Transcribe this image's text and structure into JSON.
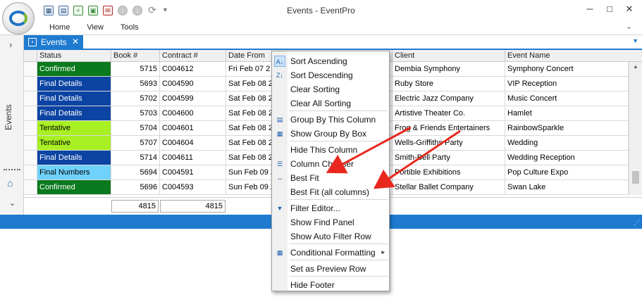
{
  "window": {
    "title": "Events - EventPro",
    "menu": [
      "Home",
      "View",
      "Tools"
    ]
  },
  "quick_access_icons": [
    "calendar-icon",
    "grid-icon",
    "add-event-icon",
    "map-icon",
    "mail-icon",
    "up-icon",
    "down-icon",
    "refresh-icon",
    "customize-icon"
  ],
  "left_nav": {
    "label": "Events"
  },
  "doc_tab": {
    "label": "Events",
    "close": "✕"
  },
  "grid": {
    "columns": [
      "Status",
      "Book #",
      "Contract #",
      "Date From",
      "",
      "Client",
      "Event Name"
    ],
    "rows": [
      {
        "status": "Confirmed",
        "status_color": "#0b7a1e",
        "book": "5715",
        "contract": "C004612",
        "date": "Fri Feb 07 2",
        "client": "Dembia Symphony",
        "event": "Symphony Concert"
      },
      {
        "status": "Final Details",
        "status_color": "#0c44a3",
        "book": "5693",
        "contract": "C004590",
        "date": "Sat Feb 08 2",
        "client": "Ruby Store",
        "event": "VIP Reception"
      },
      {
        "status": "Final Details",
        "status_color": "#0c44a3",
        "book": "5702",
        "contract": "C004599",
        "date": "Sat Feb 08 2",
        "client": "Electric Jazz Company",
        "event": "Music Concert"
      },
      {
        "status": "Final Details",
        "status_color": "#0c44a3",
        "book": "5703",
        "contract": "C004600",
        "date": "Sat Feb 08 2",
        "client": "Artistive Theater Co.",
        "event": "Hamlet"
      },
      {
        "status": "Tentative",
        "status_color": "#a8f024",
        "book": "5704",
        "contract": "C004601",
        "date": "Sat Feb 08 2",
        "client": "Frog & Friends Entertainers",
        "event": "RainbowSparkle"
      },
      {
        "status": "Tentative",
        "status_color": "#a8f024",
        "book": "5707",
        "contract": "C004604",
        "date": "Sat Feb 08 2",
        "client": "Wells-Griffiths Party",
        "event": "Wedding"
      },
      {
        "status": "Final Details",
        "status_color": "#0c44a3",
        "book": "5714",
        "contract": "C004611",
        "date": "Sat Feb 08 2",
        "client": "Smith-Bell Party",
        "event": "Wedding Reception"
      },
      {
        "status": "Final Numbers",
        "status_color": "#6fd2fb",
        "book": "5694",
        "contract": "C004591",
        "date": "Sun Feb 09 2",
        "client": "Portible Exhibitions",
        "event": "Pop Culture Expo"
      },
      {
        "status": "Confirmed",
        "status_color": "#0b7a1e",
        "book": "5696",
        "contract": "C004593",
        "date": "Sun Feb 09 2",
        "client": "Stellar Ballet Company",
        "event": "Swan Lake"
      }
    ],
    "footer": {
      "book_total": "4815",
      "contract_total": "4815"
    }
  },
  "context_menu": {
    "items": [
      {
        "label": "Sort Ascending",
        "icon": "sort-ascending-icon",
        "glyph": "A↓"
      },
      {
        "label": "Sort Descending",
        "icon": "sort-descending-icon",
        "glyph": "Z↓"
      },
      {
        "label": "Clear Sorting",
        "icon": "",
        "glyph": ""
      },
      {
        "label": "Clear All Sorting",
        "icon": "",
        "glyph": ""
      },
      {
        "label": "Group By This Column",
        "icon": "group-by-icon",
        "glyph": "▤"
      },
      {
        "label": "Show Group By Box",
        "icon": "group-box-icon",
        "glyph": "▦"
      },
      {
        "label": "Hide This Column",
        "icon": "",
        "glyph": ""
      },
      {
        "label": "Column Chooser",
        "icon": "column-chooser-icon",
        "glyph": "☰"
      },
      {
        "label": "Best Fit",
        "icon": "best-fit-icon",
        "glyph": "↔"
      },
      {
        "label": "Best Fit (all columns)",
        "icon": "",
        "glyph": ""
      },
      {
        "label": "Filter Editor...",
        "icon": "filter-icon",
        "glyph": "▼"
      },
      {
        "label": "Show Find Panel",
        "icon": "",
        "glyph": ""
      },
      {
        "label": "Show Auto Filter Row",
        "icon": "",
        "glyph": ""
      },
      {
        "label": "Conditional Formatting",
        "icon": "conditional-formatting-icon",
        "glyph": "▦",
        "submenu": "▸"
      },
      {
        "label": "Set as Preview Row",
        "icon": "",
        "glyph": ""
      },
      {
        "label": "Hide Footer",
        "icon": "",
        "glyph": ""
      }
    ]
  },
  "colors": {
    "accent": "#1e7bd0",
    "annotation_arrow": "#e8281e"
  }
}
